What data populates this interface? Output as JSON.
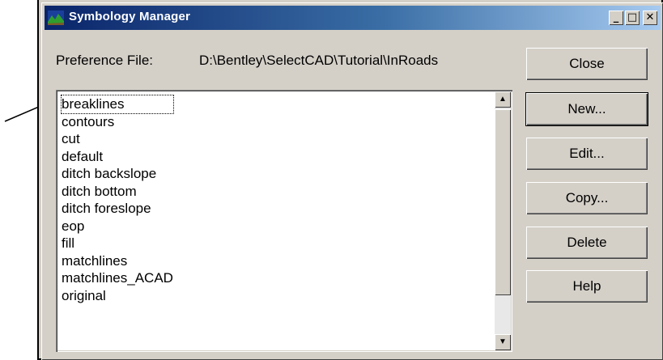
{
  "window": {
    "title": "Symbology Manager",
    "minimize_glyph": "_",
    "maximize_glyph": "□",
    "close_glyph": "✕"
  },
  "preference": {
    "label": "Preference File:",
    "path": "D:\\Bentley\\SelectCAD\\Tutorial\\InRoads"
  },
  "list": {
    "items": [
      "breaklines",
      "contours",
      "cut",
      "default",
      "ditch backslope",
      "ditch bottom",
      "ditch foreslope",
      "eop",
      "fill",
      "matchlines",
      "matchlines_ACAD",
      "original"
    ],
    "selected_index": 0
  },
  "buttons": {
    "close": "Close",
    "new": "New...",
    "edit": "Edit...",
    "copy": "Copy...",
    "delete": "Delete",
    "help": "Help"
  }
}
